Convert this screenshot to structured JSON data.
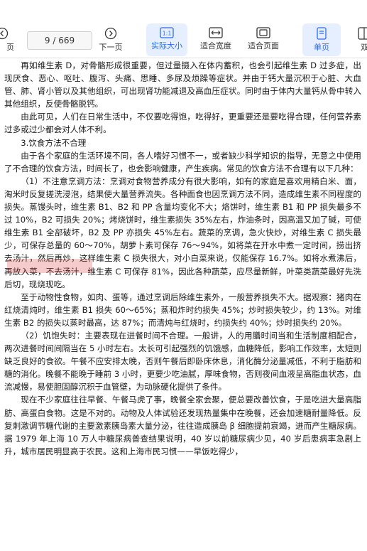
{
  "toolbar": {
    "prev_label": "页",
    "page_display": "9 / 669",
    "next_label": "下一页",
    "actual_size_label": "实际大小",
    "fit_width_label": "适合宽度",
    "fit_page_label": "适合页面",
    "single_label": "单页",
    "double_label": "双",
    "accent_color": "#2a6bf2"
  },
  "document": {
    "paragraphs": [
      "再如维生素 D，对骨骼形成很重要，但过量摄入在体内蓄积，也会引起维生素 D 过多症，出现厌食、恶心、呕吐、腹泻、头痛、思睡、多尿及烦躁等症状。并由于钙大量沉积于心脏、大血管、肺、肾小管以及其他组织，可出现肾功能减退及高血压症状。同时由于体内大量钙从骨中转入其他组织，反使骨骼脱钙。",
      "由此可见，人们在日常生活中，不仅要吃得饱，吃得好，更重要还是要吃得合理，任何营养素过多或过少都会对人体不利。",
      "3.饮食方法不合理",
      "由于各个家庭的生活环境不同，各人嗜好习惯不一，或者缺少科学知识的指导，无意之中使用了不合理的饮食方法，时间长了，也会影响健康，产生疾病。常见的饮食方法不合理有以下几种：",
      "（1）不注意烹调方法：烹调对食物营养成分有很大影响，如有的家庭是喜欢用精白米、面，淘米时反复搓洗浸泡，结果使大量营养流失。各种面食也因烹调方法不同，造成维生素不同程度的损失。蒸馒头时，维生素 B1、B2 和 PP 含量均变化不大；烙饼时，维生素 B1 和 PP 损失最多不过 10%，B2 可损失 20%；烤烧饼时，维生素损失 35%左右，炸油条时，因高温又加了碱，可使维生素 B1 全部破坏，B2 及 PP 亦损失 45%左右。蔬菜的烹调，急火快炒，对维生素 C 损失最少，可保存总量的 60～70%，胡萝卜素可保存 76～94%，如将菜在开水中煮一定时间，捞出挤去汤汁，然后再炒，这样维生素 C 损失很大，对小白菜来说，仅能保存 16.7%。如将水煮沸后，再放入菜，不去汤汁，维生素 C 可保存 81%，因此各种蔬菜，应尽量新鲜，叶菜类蔬菜最好先洗后切，现烧现吃。",
      "至于动物性食物，如肉、蛋等，通过烹调后除维生素外，一般营养损失不大。据观察：猪肉在红烧清炖时，维生素 B1 损失 60～65%；蒸和炸时约损失 45%；炒时损失较少，约 13%。对维生素 B2 的损失以蒸时最高，达 87%；而清炖与红烧时，约损失约 40%；炒时损失约 20%。",
      "（2）饥饱失时：主要表现在进餐时间不合理。一般讲，人的用膳时间当和生活制度相配合，两次进餐时间间隔当在 5 小时左右。太长可引起强烈的饥饿感，血糖降低，影响工作效率，太短则缺乏良好的食欲。午餐不应安排太晚，否则午餐后即卧床休息，消化酶分泌量减低，不利于脂肪和糖的消化。晚餐不能晚于睡前 3 小时，更要少吃油腻，厚味食物，否则夜间血液呈高脂血状态，血流减慢，易使胆固醇沉积于血管壁，为动脉硬化提供了条件。",
      "现在不少家庭往往早餐、午餐马虎了事，晚餐全家会聚，便总要改善饮食，于是吃进大量高脂肪、高蛋白食物。这是不对的。动物及人体试验还发现热量集中在晚餐，还会加速糖耐量降低。反复刺激调节糖代谢的主要激素胰岛素大量分泌，往往造成胰岛 β 细胞提前衰竭，进而产生糖尿病。据 1979 年上海 10 万人中糖尿病普查结果说明，40 岁以前糖尿病少见，40 岁后患病率急剧上升，城市居民明显高于农民。这和上海市民习惯——早饭吃得少，"
    ]
  }
}
